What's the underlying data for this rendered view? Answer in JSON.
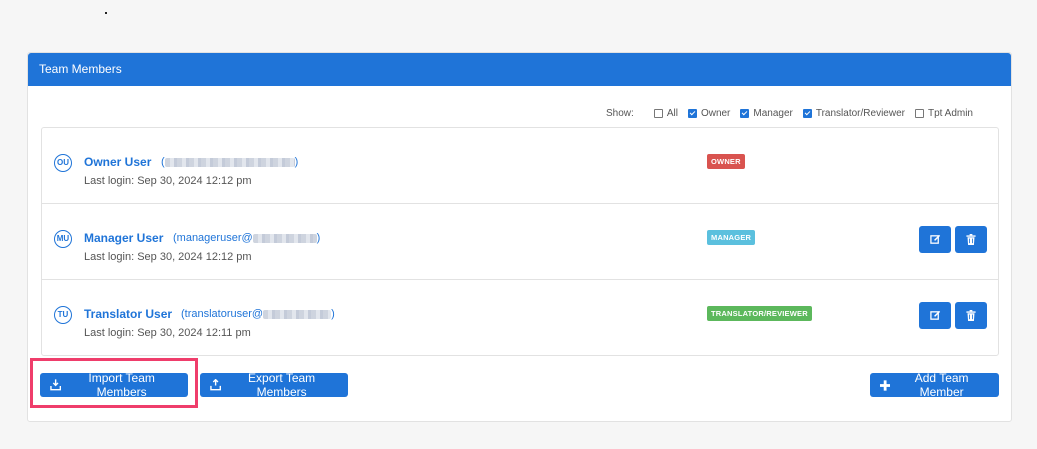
{
  "panel": {
    "title": "Team Members"
  },
  "filters": {
    "show_label": "Show:",
    "options": [
      {
        "label": "All",
        "checked": false
      },
      {
        "label": "Owner",
        "checked": true
      },
      {
        "label": "Manager",
        "checked": true
      },
      {
        "label": "Translator/Reviewer",
        "checked": true
      },
      {
        "label": "Tpt Admin",
        "checked": false
      }
    ]
  },
  "members": [
    {
      "initials": "OU",
      "name": "Owner User",
      "email_open": "(",
      "email_close": ")",
      "last_login": "Last login: Sep 30, 2024 12:12 pm",
      "role": "OWNER",
      "role_color": "#d9534f"
    },
    {
      "initials": "MU",
      "name": "Manager User",
      "email_open": "(manageruser@",
      "email_close": ")",
      "last_login": "Last login: Sep 30, 2024 12:12 pm",
      "role": "MANAGER",
      "role_color": "#5bc0de"
    },
    {
      "initials": "TU",
      "name": "Translator User",
      "email_open": "(translatoruser@",
      "email_close": ")",
      "last_login": "Last login: Sep 30, 2024 12:11 pm",
      "role": "TRANSLATOR/REVIEWER",
      "role_color": "#5cb85c"
    }
  ],
  "actions": {
    "import_label": "Import Team Members",
    "export_label": "Export Team Members",
    "add_label": "Add Team Member"
  },
  "icons": {
    "edit": "edit-icon",
    "delete": "trash-icon",
    "import": "import-icon",
    "export": "export-icon",
    "add": "plus-icon"
  },
  "colors": {
    "primary": "#1f74d8",
    "highlight": "#ef3d6b"
  }
}
